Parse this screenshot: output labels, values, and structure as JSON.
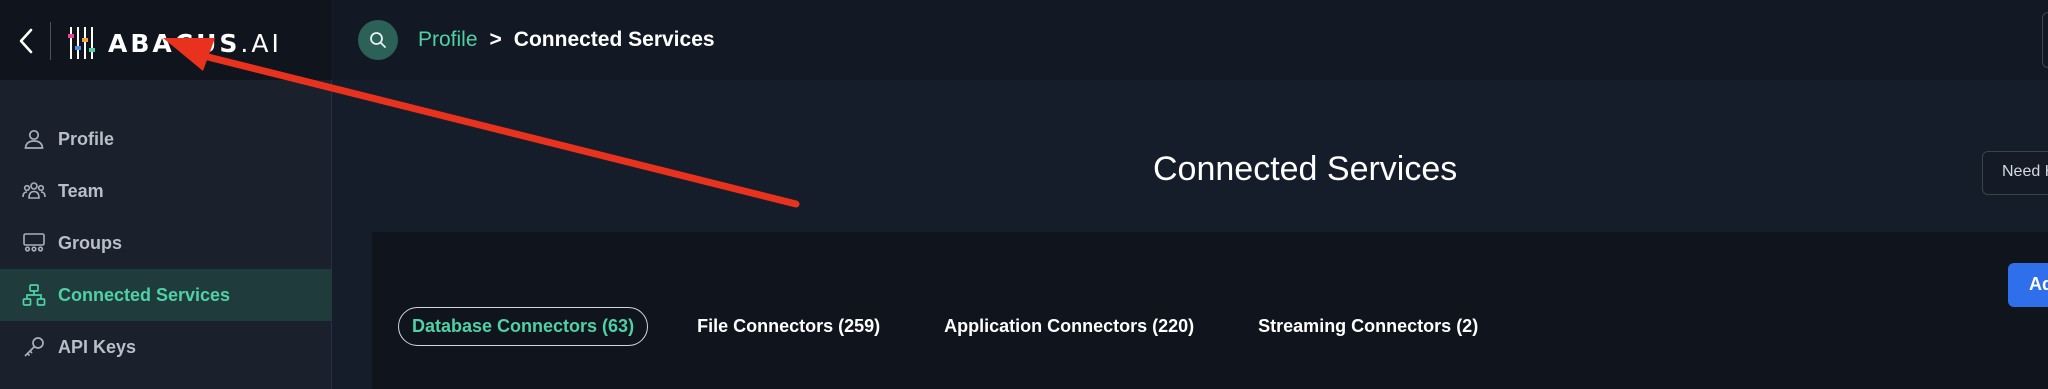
{
  "sidebar": {
    "logo_main": "ABACUS",
    "logo_suffix": ".AI",
    "items": [
      {
        "label": "Profile",
        "icon": "user-icon"
      },
      {
        "label": "Team",
        "icon": "team-icon"
      },
      {
        "label": "Groups",
        "icon": "groups-icon"
      },
      {
        "label": "Connected Services",
        "icon": "network-icon",
        "active": true
      },
      {
        "label": "API Keys",
        "icon": "key-icon"
      }
    ]
  },
  "topbar": {
    "breadcrumb": {
      "link": "Profile",
      "separator": ">",
      "current": "Connected Services"
    }
  },
  "main": {
    "title": "Connected Services",
    "help_button": "Need H",
    "add_button": "Ad",
    "tabs": [
      {
        "label": "Database Connectors (63)",
        "active": true
      },
      {
        "label": "File Connectors (259)"
      },
      {
        "label": "Application Connectors (220)"
      },
      {
        "label": "Streaming Connectors (2)"
      }
    ]
  },
  "colors": {
    "accent": "#4fd1a5",
    "annotation_arrow": "#e8321e",
    "primary_button": "#2f6fec"
  }
}
